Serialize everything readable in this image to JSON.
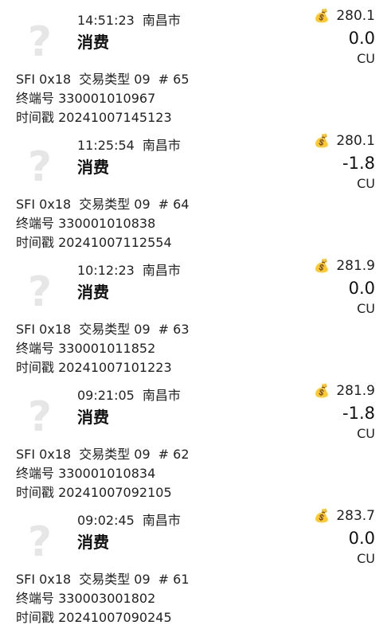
{
  "labels": {
    "sfi_prefix": "SFI",
    "txn_type_label": "交易类型",
    "hash": "#",
    "terminal_label": "终端号",
    "timestamp_label": "时间戳",
    "currency": "CU"
  },
  "colors": {
    "text": "#1a1a1a",
    "icon": "#e6e6e6",
    "background": "#ffffff"
  },
  "icons": {
    "unknown": "question-mark-icon",
    "balance": "money-bag-icon"
  },
  "records": [
    {
      "time": "14:51:23",
      "location": "南昌市",
      "type": "消费",
      "balance": "280.1",
      "amount": "0.0",
      "sfi": "0x18",
      "txn_type": "09",
      "seq": "65",
      "terminal": "330001010967",
      "timestamp": "20241007145123"
    },
    {
      "time": "11:25:54",
      "location": "南昌市",
      "type": "消费",
      "balance": "280.1",
      "amount": "-1.8",
      "sfi": "0x18",
      "txn_type": "09",
      "seq": "64",
      "terminal": "330001010838",
      "timestamp": "20241007112554"
    },
    {
      "time": "10:12:23",
      "location": "南昌市",
      "type": "消费",
      "balance": "281.9",
      "amount": "0.0",
      "sfi": "0x18",
      "txn_type": "09",
      "seq": "63",
      "terminal": "330001011852",
      "timestamp": "20241007101223"
    },
    {
      "time": "09:21:05",
      "location": "南昌市",
      "type": "消费",
      "balance": "281.9",
      "amount": "-1.8",
      "sfi": "0x18",
      "txn_type": "09",
      "seq": "62",
      "terminal": "330001010834",
      "timestamp": "20241007092105"
    },
    {
      "time": "09:02:45",
      "location": "南昌市",
      "type": "消费",
      "balance": "283.7",
      "amount": "0.0",
      "sfi": "0x18",
      "txn_type": "09",
      "seq": "61",
      "terminal": "330003001802",
      "timestamp": "20241007090245"
    }
  ]
}
